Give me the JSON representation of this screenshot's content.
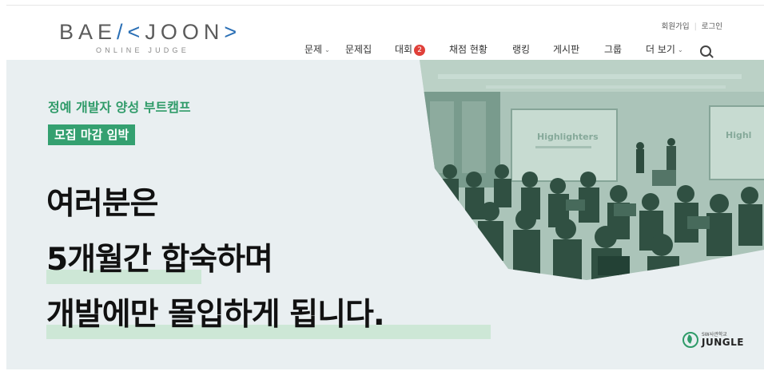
{
  "logo": {
    "main_left": "BAE",
    "main_right": "JOON",
    "bracket_open": "/<",
    "bracket_close": ">",
    "subtitle": "ONLINE JUDGE"
  },
  "util": {
    "signup": "회원가입",
    "separator": "|",
    "login": "로그인"
  },
  "nav": [
    {
      "label": "문제",
      "dropdown": true
    },
    {
      "label": "문제집",
      "dropdown": false
    },
    {
      "label": "대회",
      "badge": "2"
    },
    {
      "label": "채점 현황"
    },
    {
      "label": "랭킹"
    },
    {
      "label": "게시판"
    },
    {
      "label": "그룹"
    },
    {
      "label": "더 보기",
      "dropdown": true
    }
  ],
  "banner": {
    "eyebrow": "정예 개발자 양성 부트캠프",
    "pill": "모집 마감 임박",
    "headline": [
      "여러분은",
      "5개월간 합숙하며",
      "개발에만 몰입하게 됩니다."
    ],
    "photo_screen_text": "Highlighters",
    "photo_screen_text_2": "Highl",
    "sponsor_small": "SW사관학교",
    "sponsor_big": "JUNGLE",
    "accent_color": "#34a070",
    "highlight_color": "#cde7d6"
  },
  "icons": {
    "search": "search-icon",
    "dropdown": "chevron-down-icon",
    "jungle": "jungle-logo-icon"
  }
}
